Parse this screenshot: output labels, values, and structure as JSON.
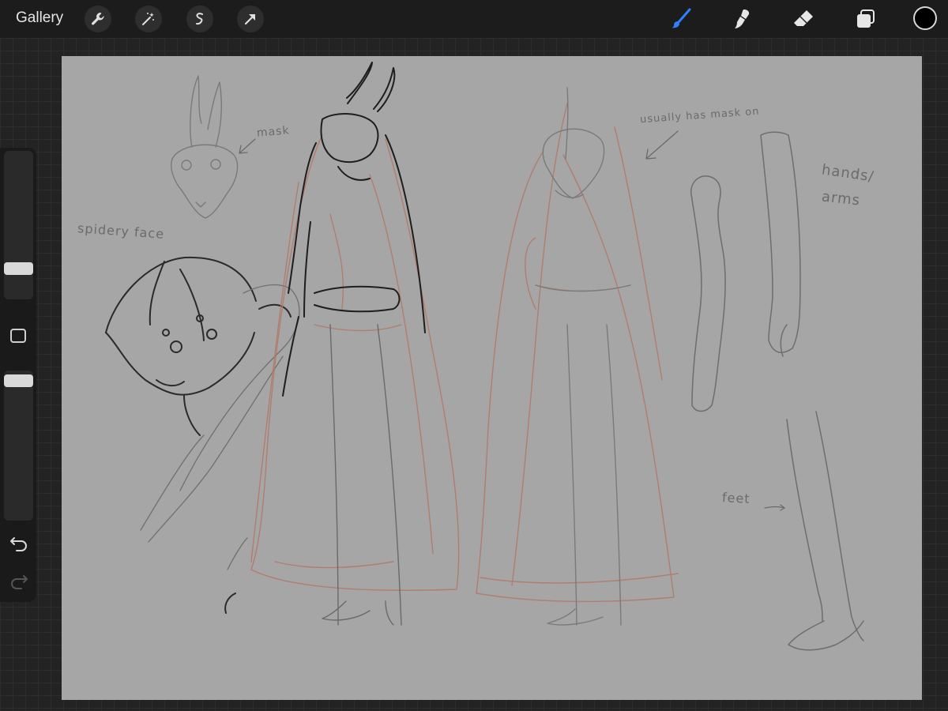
{
  "toolbar": {
    "gallery_label": "Gallery",
    "left_tools": [
      "wrench-icon",
      "magic-wand-icon",
      "selection-icon",
      "transform-arrow-icon"
    ],
    "right_tools": [
      "brush-icon",
      "smudge-icon",
      "eraser-icon",
      "layers-icon"
    ],
    "active_tool": "brush-icon",
    "accent_color": "#2f80ff",
    "current_color": "#000000"
  },
  "sidebar": {
    "brush_size_level": 0.18,
    "opacity_level": 0.03,
    "tools": [
      "modify-square-icon",
      "undo-icon",
      "redo-icon"
    ]
  },
  "canvas": {
    "background_color": "#a6a6a6",
    "annotations": {
      "mask": "mask",
      "usually": "usually has mask on",
      "hands": "hands/",
      "arms": "arms",
      "spidery": "spidery face",
      "feet": "feet"
    }
  }
}
